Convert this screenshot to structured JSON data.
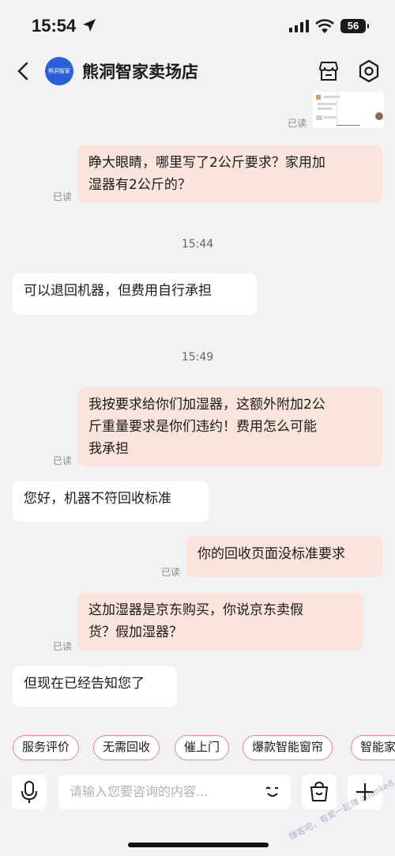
{
  "status_bar": {
    "time": "15:54",
    "battery": "56"
  },
  "header": {
    "shop_name": "熊洞智家卖场店",
    "avatar_text": "熊洞智家"
  },
  "image_message": {
    "read": "已读"
  },
  "messages": [
    {
      "text_lines": [
        "睁大眼睛，哪里写了2公斤要求？家用加",
        "湿器有2公斤的？"
      ],
      "read": "已读"
    },
    {
      "time": "15:44"
    },
    {
      "text": "可以退回机器，但费用自行承担"
    },
    {
      "time": "15:49"
    },
    {
      "text_lines": [
        "我按要求给你们加湿器，这额外附加2公",
        "斤重量要求是你们违约！费用怎么可能",
        "我承担"
      ],
      "read": "已读"
    },
    {
      "text": "您好，机器不符回收标准"
    },
    {
      "text": "你的回收页面没标准要求",
      "read": "已读"
    },
    {
      "text_lines": [
        "这加湿器是京东购买，你说京东卖假",
        "货？假加湿器？"
      ],
      "read": "已读"
    },
    {
      "text": "但现在已经告知您了"
    }
  ],
  "quick_replies": [
    "服务评价",
    "无需回收",
    "催上门",
    "爆款智能窗帘",
    "智能家"
  ],
  "input": {
    "placeholder": "请输入您要咨询的内容..."
  },
  "watermark": "赚客吧，有奖一起赚 zuanke8.com"
}
